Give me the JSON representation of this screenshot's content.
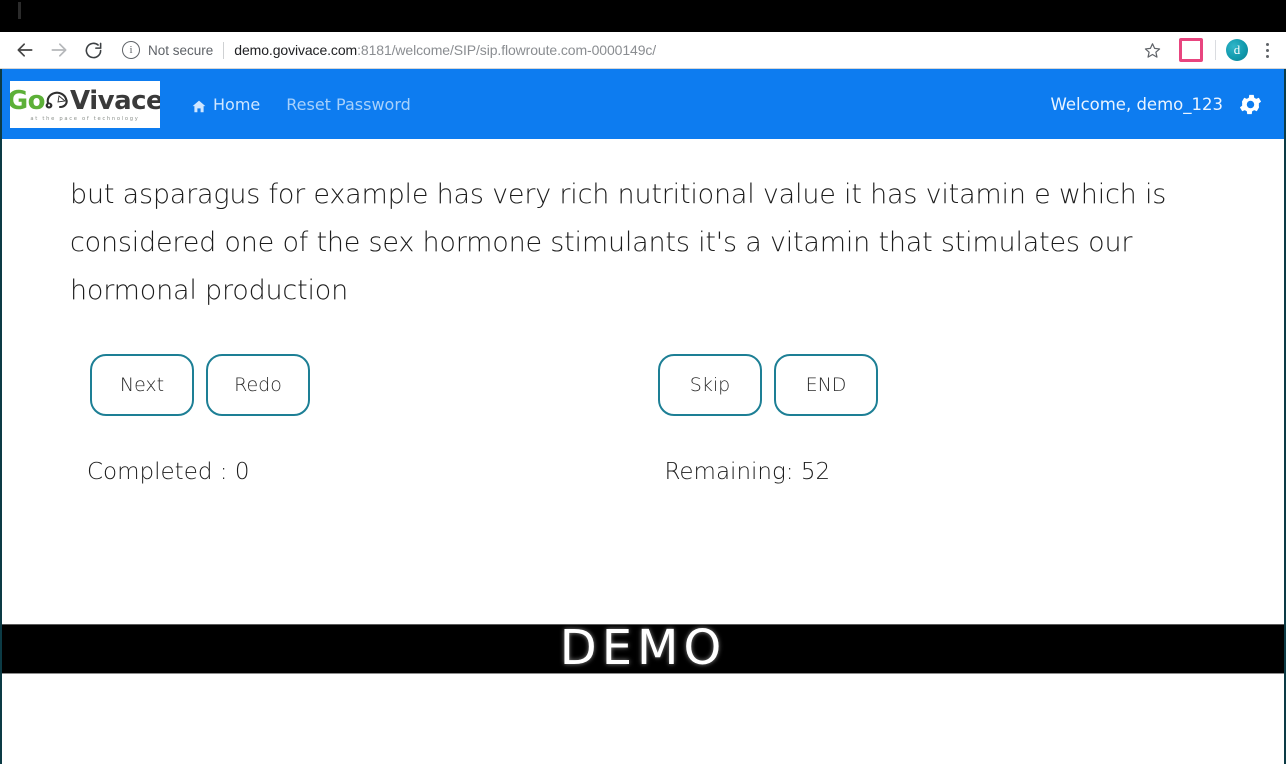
{
  "browser": {
    "back_icon": "back-arrow-icon",
    "forward_icon": "forward-arrow-icon",
    "reload_icon": "reload-icon",
    "info_glyph": "i",
    "security_label": "Not secure",
    "url_host": "demo.govivace.com",
    "url_path": ":8181/welcome/SIP/sip.flowroute.com-0000149c/",
    "url_full": "demo.govivace.com:8181/welcome/SIP/sip.flowroute.com-0000149c/",
    "star_icon": "bookmark-star-icon",
    "extension_icon": "extension-icon",
    "extension_color": "#e8457f",
    "avatar_initial": "d",
    "avatar_color": "#119aad",
    "menu_icon": "three-dot-menu-icon"
  },
  "appbar": {
    "brand_color": "#0d7cf0",
    "logo": {
      "go": "Go",
      "vivace": "Vivace",
      "tagline": "at the pace of technology",
      "go_color": "#5cb037",
      "vivace_color": "#3a3a3a"
    },
    "nav": [
      {
        "label": "Home",
        "icon": "home-icon"
      },
      {
        "label": "Reset Password",
        "icon": ""
      }
    ],
    "welcome": "Welcome, demo_123",
    "gear_icon": "gear-icon"
  },
  "main": {
    "transcript": "but asparagus for example has very rich nutritional value it has vitamin e which is considered one of the sex hormone stimulants it's a vitamin that stimulates our hormonal production",
    "buttons": {
      "next": "Next",
      "redo": "Redo",
      "skip": "Skip",
      "end": "END"
    },
    "button_border_color": "#1d7f95",
    "status": {
      "completed": "Completed : 0",
      "remaining": "Remaining: 52"
    }
  },
  "watermark": {
    "text": "DEMO"
  }
}
